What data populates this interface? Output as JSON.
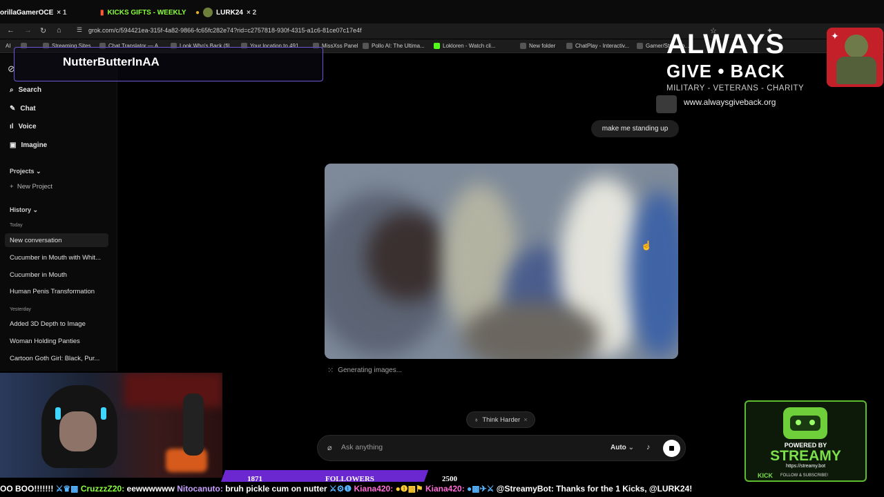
{
  "tabs": [
    {
      "label": "orillaGamerOCE",
      "count": "× 1",
      "color": "#ffffff"
    },
    {
      "label": "KICKS GIFTS - WEEKLY",
      "count": "",
      "color": "#8aff3a"
    },
    {
      "label": "LURK24",
      "count": "× 2",
      "color": "#ffffff"
    }
  ],
  "browser": {
    "url": "grok.com/c/594421ea-315f-4a82-9866-fc65fc282e74?rid=c2757818-930f-4315-a1c6-81ce07c17e4f"
  },
  "bookmarks": [
    "AI",
    "Streaming Sites",
    "Chat Translator — A...",
    "Look Who's Back (fil...",
    "Your location to 491...",
    "MissXss Panel",
    "Pollo AI: The Ultima...",
    "Lokloren - Watch cli...",
    "New folder",
    "ChatPlay - Interactiv...",
    "Gamer/Stre... lo..."
  ],
  "overlay": {
    "name": "NutterButterInAA"
  },
  "sidebar": {
    "nav": [
      {
        "label": "Search",
        "icon": "search-icon"
      },
      {
        "label": "Chat",
        "icon": "chat-icon"
      },
      {
        "label": "Voice",
        "icon": "voice-icon"
      },
      {
        "label": "Imagine",
        "icon": "image-icon"
      }
    ],
    "projects_label": "Projects",
    "new_project": "New Project",
    "history_label": "History",
    "today_label": "Today",
    "today_items": [
      "New conversation",
      "Cucumber in Mouth with Whit...",
      "Cucumber in Mouth",
      "Human Penis Transformation"
    ],
    "yesterday_label": "Yesterday",
    "yesterday_items": [
      "Added 3D Depth to Image",
      "Woman Holding Panties",
      "Cartoon Goth Girl: Black, Pur..."
    ]
  },
  "chat": {
    "user_message": "make me standing up",
    "generating": "Generating images...",
    "think_harder": "Think Harder",
    "input_placeholder": "Ask anything",
    "model": "Auto"
  },
  "brand": {
    "line1": "ALWAYS",
    "line2": "GIVE • BACK",
    "tagline": "MILITARY - VETERANS - CHARITY",
    "url": "www.alwaysgiveback.org"
  },
  "streamy": {
    "powered_by": "POWERED BY",
    "name": "STREAMY",
    "url": "https://streamy.bot",
    "kick": "KICK",
    "follow": "FOLLOW & SUBSCRIBE!"
  },
  "followers": {
    "current": "1871",
    "label": "FOLLOWERS",
    "goal": "2500"
  },
  "ticker": {
    "lead": "OO BOO!!!!!!!",
    "messages": [
      {
        "name": "CruzzzZ20:",
        "text": " eewwwwww"
      },
      {
        "name": "Nitocanuto:",
        "text": " bruh pickle cum on nutter"
      },
      {
        "name": "Kiana420:",
        "text": ""
      },
      {
        "name": "Kiana420:",
        "text": ""
      },
      {
        "name": "@StreamyBot:",
        "text": " Thanks for the 1 Kicks, @LURK24!"
      }
    ]
  },
  "colors": {
    "accent_purple": "#6b28d0",
    "streamy_green": "#5dbd2f",
    "ticker_name": "#8aff3a"
  }
}
